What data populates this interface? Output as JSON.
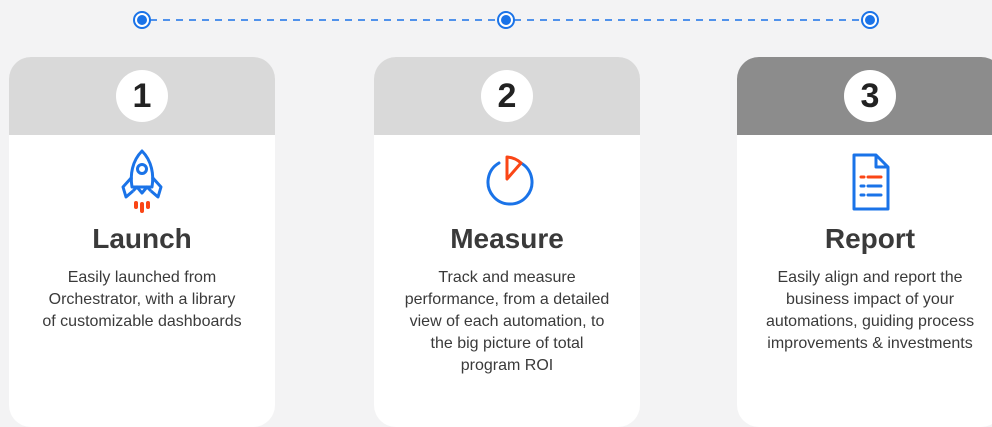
{
  "colors": {
    "accent_blue": "#1a73e8",
    "accent_orange": "#fa4616",
    "header_light": "#d9d9d9",
    "header_dark": "#8c8c8c",
    "page_bg": "#f3f3f4",
    "card_bg": "#ffffff",
    "text": "#3a3a3a"
  },
  "steps": [
    {
      "number": "1",
      "title": "Launch",
      "icon": "rocket-icon",
      "description": "Easily launched from\nOrchestrator, with a library\nof customizable dashboards"
    },
    {
      "number": "2",
      "title": "Measure",
      "icon": "pie-chart-icon",
      "description": "Track and measure\nperformance, from a detailed\nview of each automation, to\nthe big picture of total\nprogram ROI"
    },
    {
      "number": "3",
      "title": "Report",
      "icon": "document-list-icon",
      "description": "Easily align and report the\nbusiness impact of your\nautomations, guiding process\nimprovements & investments"
    }
  ]
}
